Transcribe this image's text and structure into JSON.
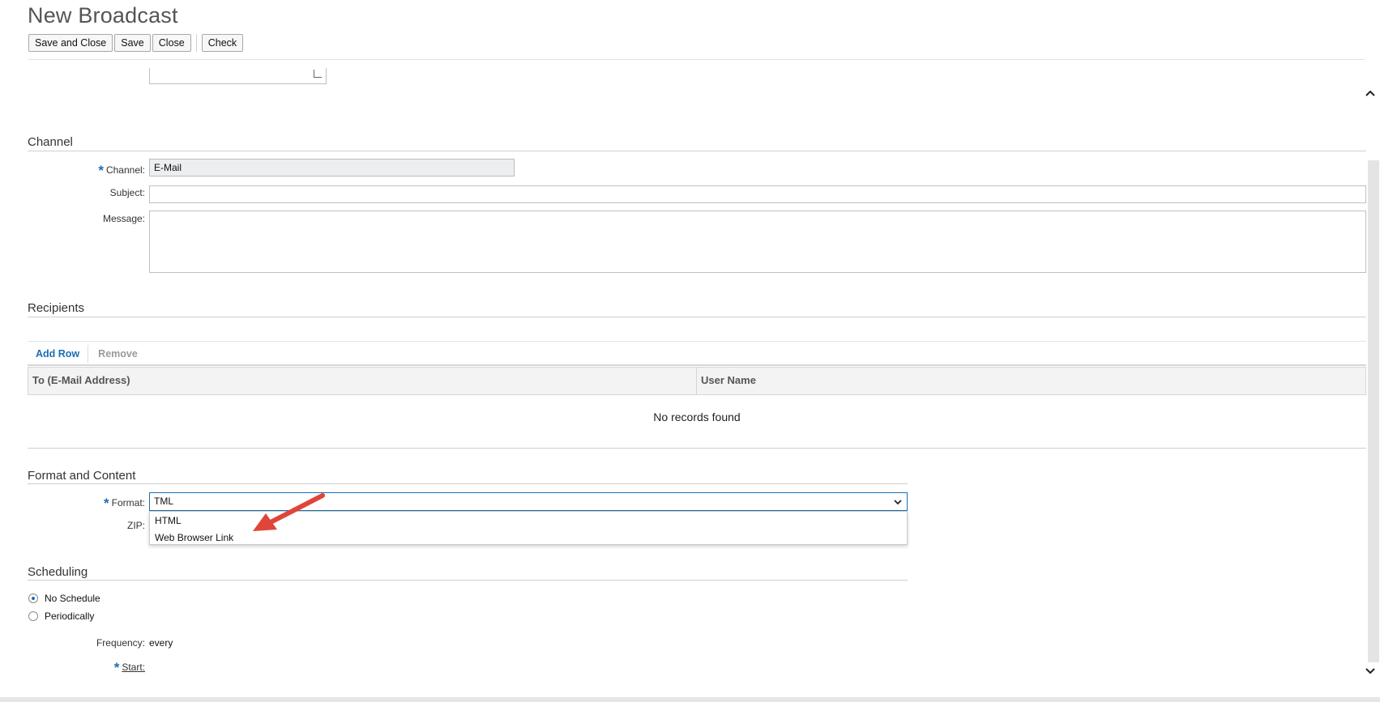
{
  "page": {
    "title": "New Broadcast"
  },
  "toolbar": {
    "save_and_close": "Save and Close",
    "save": "Save",
    "close": "Close",
    "check": "Check"
  },
  "channel_section": {
    "title": "Channel",
    "channel_label": "Channel:",
    "channel_value": "E-Mail",
    "subject_label": "Subject:",
    "subject_value": "",
    "message_label": "Message:",
    "message_value": ""
  },
  "recipients_section": {
    "title": "Recipients",
    "add_row": "Add Row",
    "remove": "Remove",
    "columns": [
      "To (E-Mail Address)",
      "User Name"
    ],
    "empty_text": "No records found"
  },
  "format_section": {
    "title": "Format and Content",
    "format_label": "Format:",
    "format_value": "TML",
    "zip_label": "ZIP:",
    "options": [
      "HTML",
      "Web Browser Link"
    ]
  },
  "scheduling_section": {
    "title": "Scheduling",
    "options": [
      "No Schedule",
      "Periodically"
    ],
    "selected": "No Schedule",
    "frequency_label": "Frequency:",
    "frequency_value": "every",
    "start_label": "Start:"
  },
  "colors": {
    "accent": "#1a6fb5",
    "annotation_arrow": "#e0453a"
  },
  "icons": [
    "chevron-up-icon",
    "chevron-down-icon",
    "dropdown-chevron-icon",
    "annotation-arrow-icon"
  ]
}
